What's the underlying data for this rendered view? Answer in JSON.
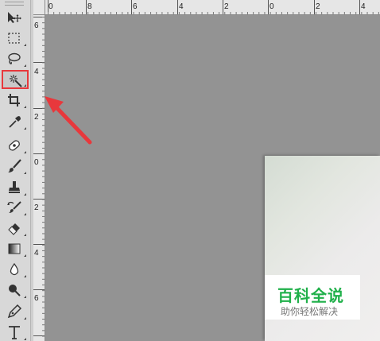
{
  "colors": {
    "canvas_bg": "#939393",
    "highlight": "#e8383c",
    "watermark_green": "#20b04a"
  },
  "toolbar": {
    "tools": [
      {
        "icon": "move-icon"
      },
      {
        "icon": "rectangular-marquee-icon"
      },
      {
        "icon": "lasso-icon"
      },
      {
        "icon": "magic-wand-icon",
        "selected": true
      },
      {
        "icon": "crop-icon"
      },
      {
        "icon": "eyedropper-icon"
      },
      {
        "icon": "healing-brush-icon"
      },
      {
        "icon": "brush-icon"
      },
      {
        "icon": "clone-stamp-icon"
      },
      {
        "icon": "history-brush-icon"
      },
      {
        "icon": "eraser-icon"
      },
      {
        "icon": "gradient-icon"
      },
      {
        "icon": "blur-icon"
      },
      {
        "icon": "dodge-icon"
      },
      {
        "icon": "pen-icon"
      },
      {
        "icon": "type-icon"
      }
    ]
  },
  "rulers": {
    "top_labels": [
      "0",
      "8",
      "6",
      "4",
      "2",
      "0",
      "2",
      "4"
    ],
    "left_labels": [
      "6",
      "4",
      "2",
      "0",
      "2",
      "4",
      "6"
    ]
  },
  "watermark": {
    "title": "百科全说",
    "subtitle": "助你轻松解决"
  }
}
